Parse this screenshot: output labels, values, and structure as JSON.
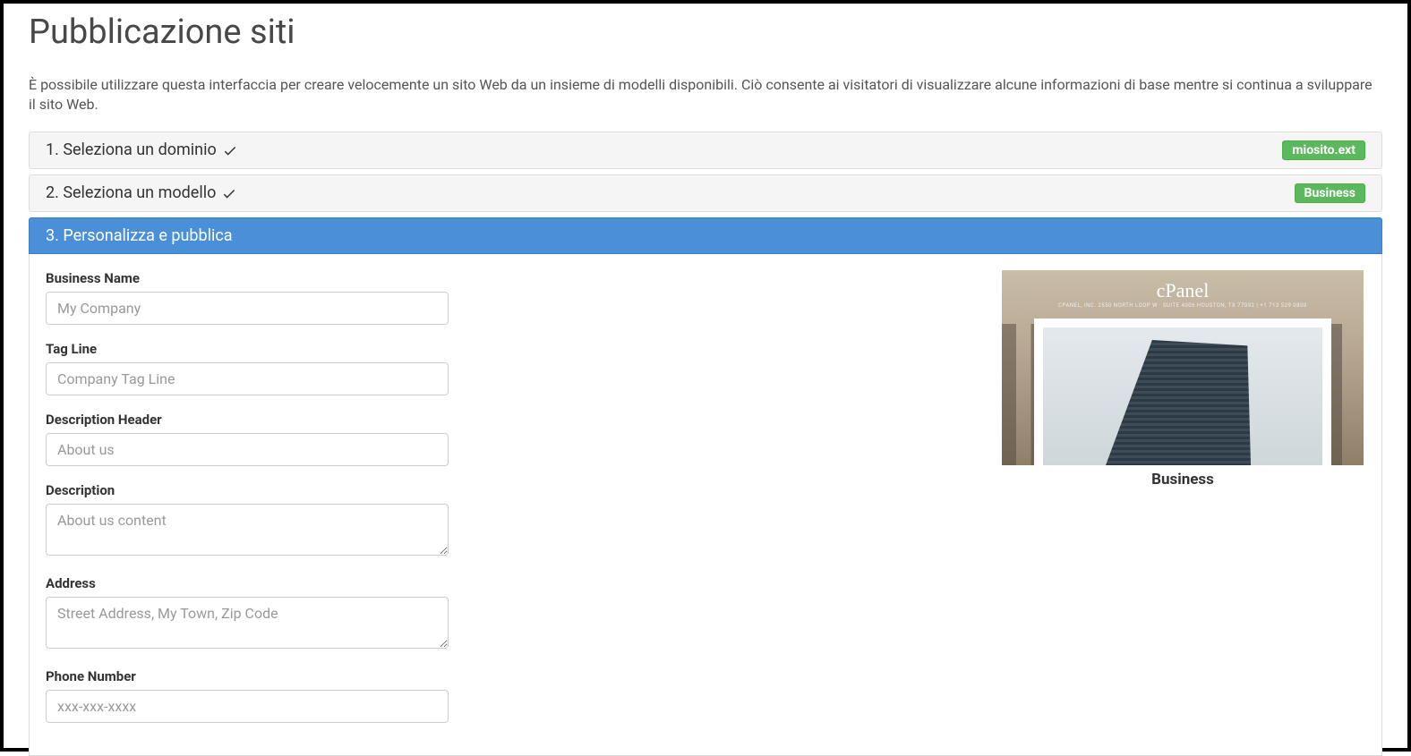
{
  "page": {
    "title": "Pubblicazione siti",
    "intro": "È possibile utilizzare questa interfaccia per creare velocemente un sito Web da un insieme di modelli disponibili. Ciò consente ai visitatori di visualizzare alcune informazioni di base mentre si continua a sviluppare il sito Web."
  },
  "steps": {
    "step1": {
      "title": "1. Seleziona un dominio",
      "badge": "miosito.ext"
    },
    "step2": {
      "title": "2. Seleziona un modello",
      "badge": "Business"
    },
    "step3": {
      "title": "3. Personalizza e pubblica"
    }
  },
  "form": {
    "business_name": {
      "label": "Business Name",
      "placeholder": "My Company"
    },
    "tag_line": {
      "label": "Tag Line",
      "placeholder": "Company Tag Line"
    },
    "desc_header": {
      "label": "Description Header",
      "placeholder": "About us"
    },
    "description": {
      "label": "Description",
      "placeholder": "About us content"
    },
    "address": {
      "label": "Address",
      "placeholder": "Street Address, My Town, Zip Code"
    },
    "phone": {
      "label": "Phone Number",
      "placeholder": "xxx-xxx-xxxx"
    }
  },
  "preview": {
    "logo": "cPanel",
    "subline": "CPANEL, INC. 2550 NORTH LOOP W · SUITE 4006 HOUSTON, TX 77092 | +1 713 529 0800",
    "label": "Business"
  }
}
